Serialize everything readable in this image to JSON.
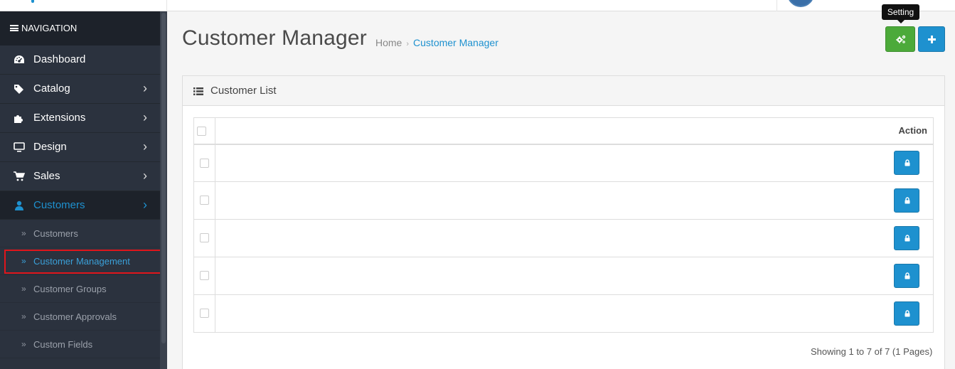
{
  "nav": {
    "heading": "NAVIGATION",
    "items": [
      {
        "label": "Dashboard",
        "icon": "dashboard-icon",
        "has_children": false
      },
      {
        "label": "Catalog",
        "icon": "tags-icon",
        "has_children": true
      },
      {
        "label": "Extensions",
        "icon": "puzzle-icon",
        "has_children": true
      },
      {
        "label": "Design",
        "icon": "desktop-icon",
        "has_children": true
      },
      {
        "label": "Sales",
        "icon": "shopping-cart-icon",
        "has_children": true
      },
      {
        "label": "Customers",
        "icon": "user-icon",
        "has_children": true,
        "active": true
      }
    ],
    "sub_items": [
      {
        "label": "Customers"
      },
      {
        "label": "Customer Management",
        "current": true
      },
      {
        "label": "Customer Groups"
      },
      {
        "label": "Customer Approvals"
      },
      {
        "label": "Custom Fields"
      }
    ]
  },
  "page": {
    "title": "Customer Manager",
    "breadcrumb": [
      "Home",
      "Customer Manager"
    ]
  },
  "toolbar": {
    "setting_tooltip": "Setting",
    "setting_icon": "cogs-icon",
    "add_icon": "plus-icon"
  },
  "panel": {
    "title": "Customer List",
    "table": {
      "header_action": "Action",
      "rows": [
        {},
        {},
        {},
        {},
        {}
      ]
    },
    "pagination_info": "Showing 1 to 7 of 7 (1 Pages)"
  },
  "colors": {
    "sidebar_bg": "#2b323e",
    "accent": "#1e91cf",
    "success": "#4caa3a",
    "highlight": "#e0151b"
  }
}
